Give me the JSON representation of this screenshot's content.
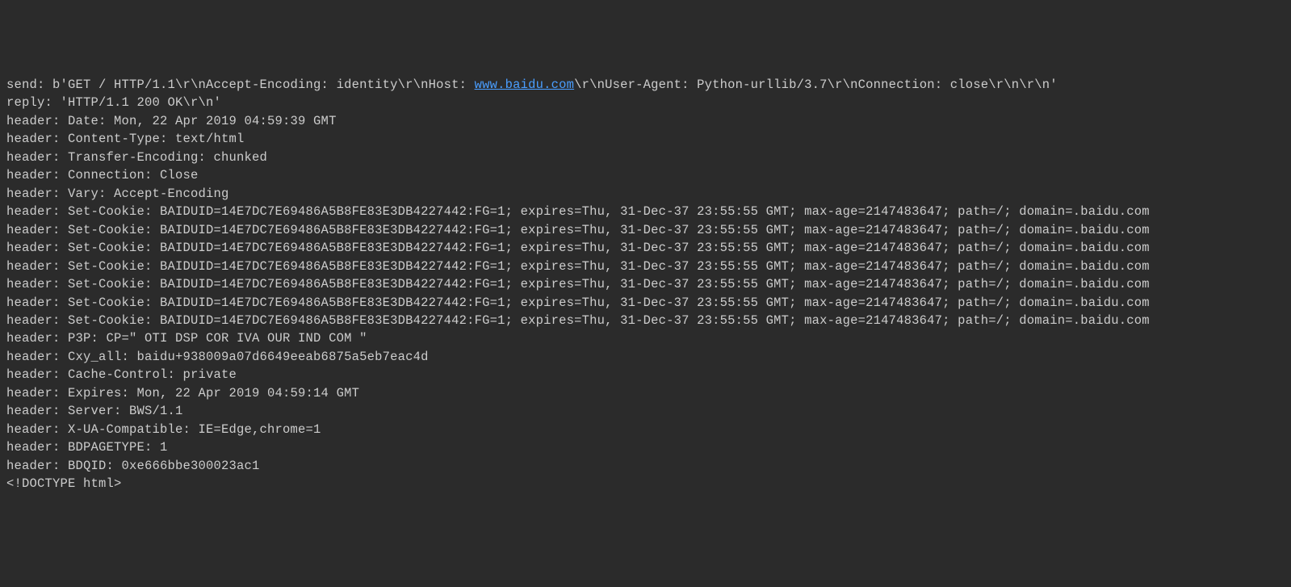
{
  "terminal": {
    "lines": [
      {
        "prefix": "send: b'GET / HTTP/1.1\\r\\nAccept-Encoding: identity\\r\\nHost: ",
        "link": "www.baidu.com",
        "suffix": "\\r\\nUser-Agent: Python-urllib/3.7\\r\\nConnection: close\\r\\n\\r\\n'"
      },
      {
        "text": "reply: 'HTTP/1.1 200 OK\\r\\n'"
      },
      {
        "text": "header: Date: Mon, 22 Apr 2019 04:59:39 GMT"
      },
      {
        "text": "header: Content-Type: text/html"
      },
      {
        "text": "header: Transfer-Encoding: chunked"
      },
      {
        "text": "header: Connection: Close"
      },
      {
        "text": "header: Vary: Accept-Encoding"
      },
      {
        "text": "header: Set-Cookie: BAIDUID=14E7DC7E69486A5B8FE83E3DB4227442:FG=1; expires=Thu, 31-Dec-37 23:55:55 GMT; max-age=2147483647; path=/; domain=.baidu.com"
      },
      {
        "text": "header: Set-Cookie: BAIDUID=14E7DC7E69486A5B8FE83E3DB4227442:FG=1; expires=Thu, 31-Dec-37 23:55:55 GMT; max-age=2147483647; path=/; domain=.baidu.com"
      },
      {
        "text": "header: Set-Cookie: BAIDUID=14E7DC7E69486A5B8FE83E3DB4227442:FG=1; expires=Thu, 31-Dec-37 23:55:55 GMT; max-age=2147483647; path=/; domain=.baidu.com"
      },
      {
        "text": "header: Set-Cookie: BAIDUID=14E7DC7E69486A5B8FE83E3DB4227442:FG=1; expires=Thu, 31-Dec-37 23:55:55 GMT; max-age=2147483647; path=/; domain=.baidu.com"
      },
      {
        "text": "header: Set-Cookie: BAIDUID=14E7DC7E69486A5B8FE83E3DB4227442:FG=1; expires=Thu, 31-Dec-37 23:55:55 GMT; max-age=2147483647; path=/; domain=.baidu.com"
      },
      {
        "text": "header: Set-Cookie: BAIDUID=14E7DC7E69486A5B8FE83E3DB4227442:FG=1; expires=Thu, 31-Dec-37 23:55:55 GMT; max-age=2147483647; path=/; domain=.baidu.com"
      },
      {
        "text": "header: Set-Cookie: BAIDUID=14E7DC7E69486A5B8FE83E3DB4227442:FG=1; expires=Thu, 31-Dec-37 23:55:55 GMT; max-age=2147483647; path=/; domain=.baidu.com"
      },
      {
        "text": "header: P3P: CP=\" OTI DSP COR IVA OUR IND COM \""
      },
      {
        "text": "header: Cxy_all: baidu+938009a07d6649eeab6875a5eb7eac4d"
      },
      {
        "text": "header: Cache-Control: private"
      },
      {
        "text": "header: Expires: Mon, 22 Apr 2019 04:59:14 GMT"
      },
      {
        "text": "header: Server: BWS/1.1"
      },
      {
        "text": "header: X-UA-Compatible: IE=Edge,chrome=1"
      },
      {
        "text": "header: BDPAGETYPE: 1"
      },
      {
        "text": "header: BDQID: 0xe666bbe300023ac1"
      },
      {
        "text": "<!DOCTYPE html>"
      }
    ]
  }
}
